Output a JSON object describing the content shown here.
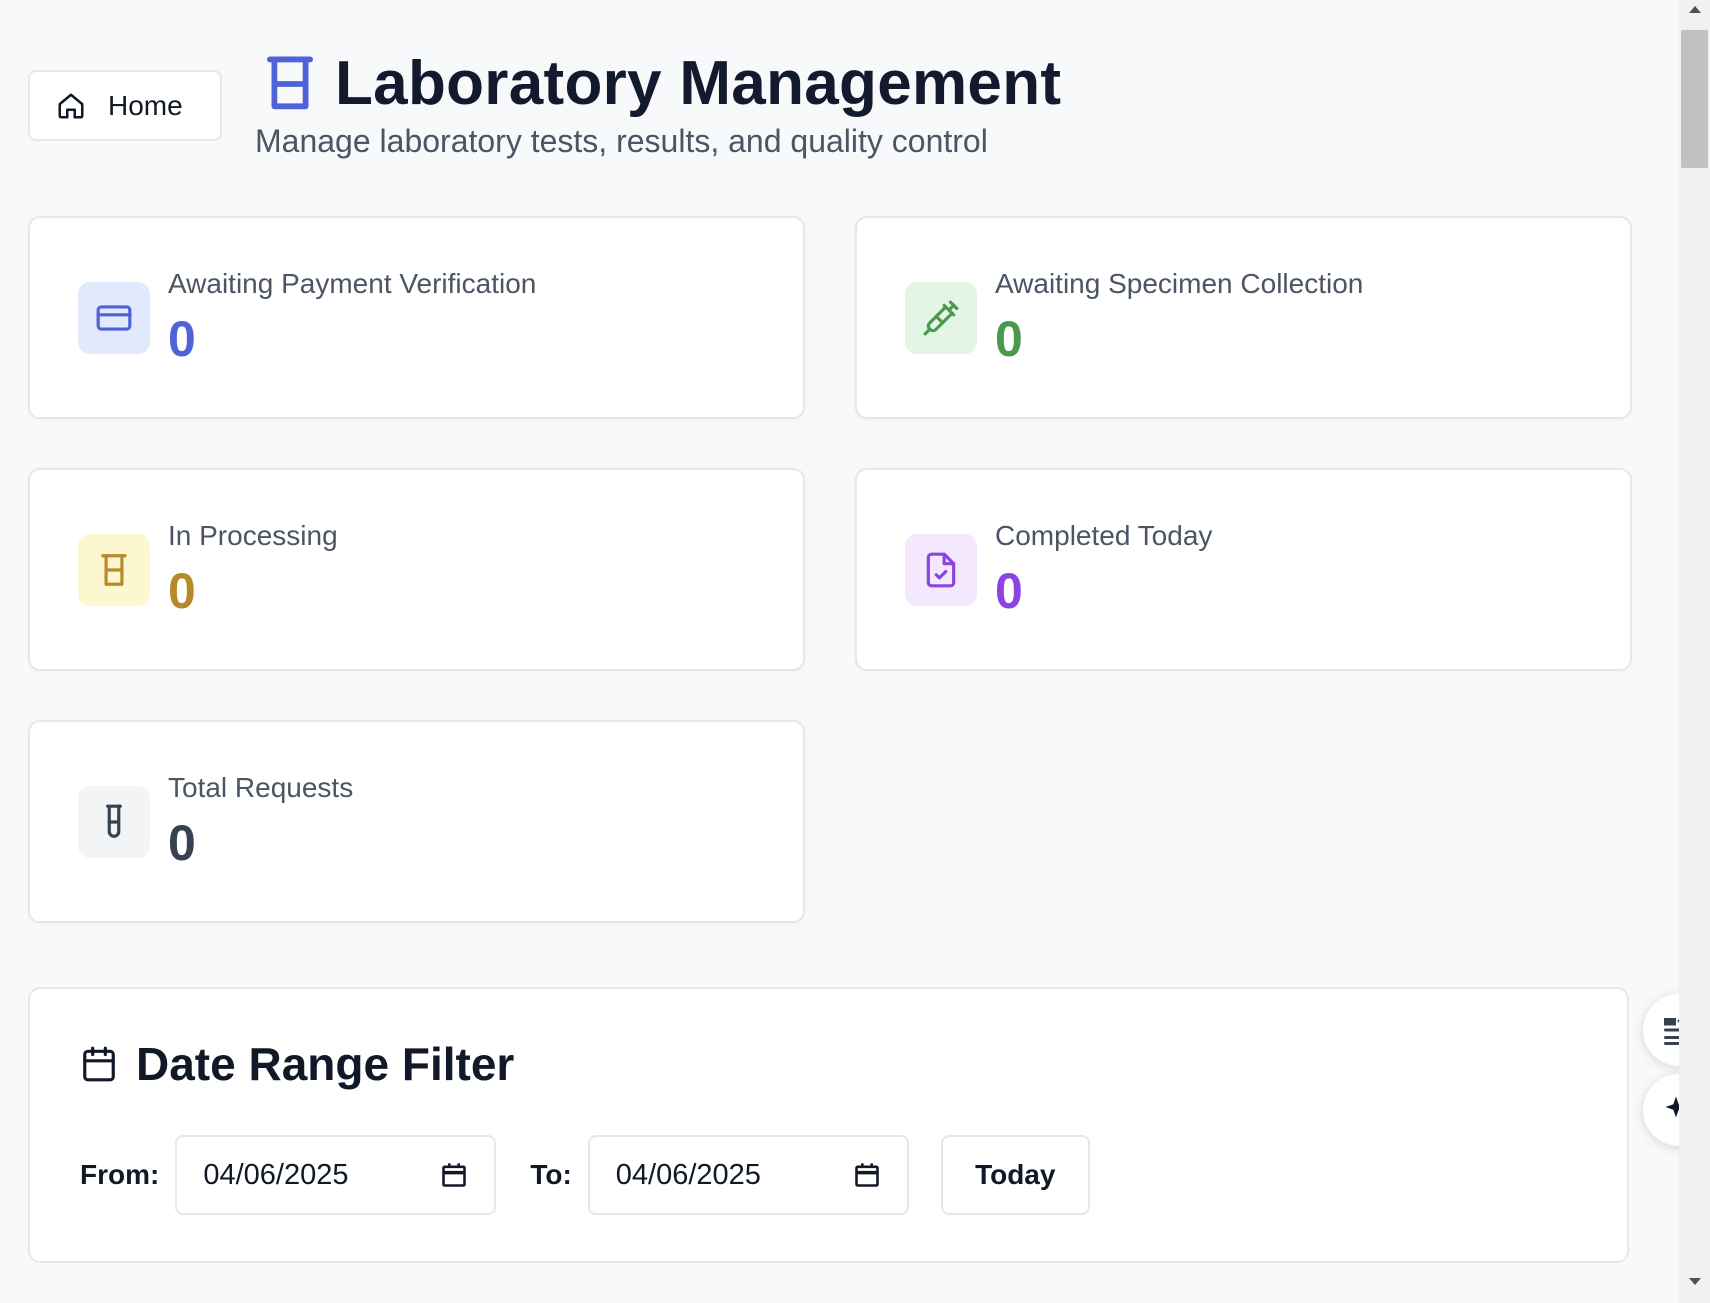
{
  "header": {
    "home_label": "Home",
    "title": "Laboratory Management",
    "subtitle": "Manage laboratory tests, results, and quality control"
  },
  "stats": [
    {
      "label": "Awaiting Payment Verification",
      "value": "0",
      "icon": "credit-card-icon",
      "color": "#4f63d9",
      "bg": "#e3e9fc"
    },
    {
      "label": "Awaiting Specimen Collection",
      "value": "0",
      "icon": "syringe-icon",
      "color": "#4a9a4e",
      "bg": "#e3f6e6"
    },
    {
      "label": "In Processing",
      "value": "0",
      "icon": "beaker-icon",
      "color": "#b8892a",
      "bg": "#fdf7cf"
    },
    {
      "label": "Completed Today",
      "value": "0",
      "icon": "file-check-icon",
      "color": "#8b44e0",
      "bg": "#f3e8fd"
    },
    {
      "label": "Total Requests",
      "value": "0",
      "icon": "test-tube-icon",
      "color": "#374151",
      "bg": "#f3f4f6"
    }
  ],
  "filter": {
    "title": "Date Range Filter",
    "from_label": "From:",
    "from_value": "04/06/2025",
    "to_label": "To:",
    "to_value": "04/06/2025",
    "today_label": "Today"
  },
  "colors": {
    "accent": "#4f63d9",
    "title": "#141a2e",
    "muted": "#4b5563"
  }
}
